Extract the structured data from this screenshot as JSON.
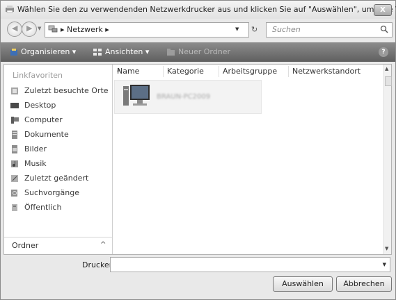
{
  "window": {
    "title": "Wählen Sie den zu verwendenden Netzwerkdrucker aus und klicken Sie auf \"Auswählen\", um eine V...",
    "close_label": "X"
  },
  "address_bar": {
    "path": "▸ Netzwerk ▸",
    "refresh_glyph": "↻"
  },
  "search": {
    "placeholder": "Suchen"
  },
  "toolbar": {
    "organize_label": "Organisieren ▾",
    "views_label": "Ansichten ▾",
    "new_folder_label": "Neuer Ordner",
    "help_label": "?"
  },
  "sidebar": {
    "header": "Linkfavoriten",
    "items": [
      {
        "label": "Zuletzt besuchte Orte",
        "icon": "recent-places-icon"
      },
      {
        "label": "Desktop",
        "icon": "desktop-icon"
      },
      {
        "label": "Computer",
        "icon": "computer-icon"
      },
      {
        "label": "Dokumente",
        "icon": "documents-icon"
      },
      {
        "label": "Bilder",
        "icon": "pictures-icon"
      },
      {
        "label": "Musik",
        "icon": "music-icon"
      },
      {
        "label": "Zuletzt geändert",
        "icon": "recently-changed-icon"
      },
      {
        "label": "Suchvorgänge",
        "icon": "searches-icon"
      },
      {
        "label": "Öffentlich",
        "icon": "public-icon"
      }
    ],
    "folders_label": "Ordner",
    "folders_chevron": "^"
  },
  "file_list": {
    "columns": [
      "Name",
      "Kategorie",
      "Arbeitsgruppe",
      "Netzwerkstandort"
    ],
    "items": [
      {
        "label": "BRAUN-PC2009",
        "icon": "network-computer-icon"
      }
    ]
  },
  "footer": {
    "printer_label": "Drucker",
    "printer_value": "",
    "select_button": "Auswählen",
    "cancel_button": "Abbrechen"
  },
  "colors": {
    "toolbar": "#6f6f6f",
    "window_background": "#e9e9e9",
    "content_background": "#ffffff"
  }
}
